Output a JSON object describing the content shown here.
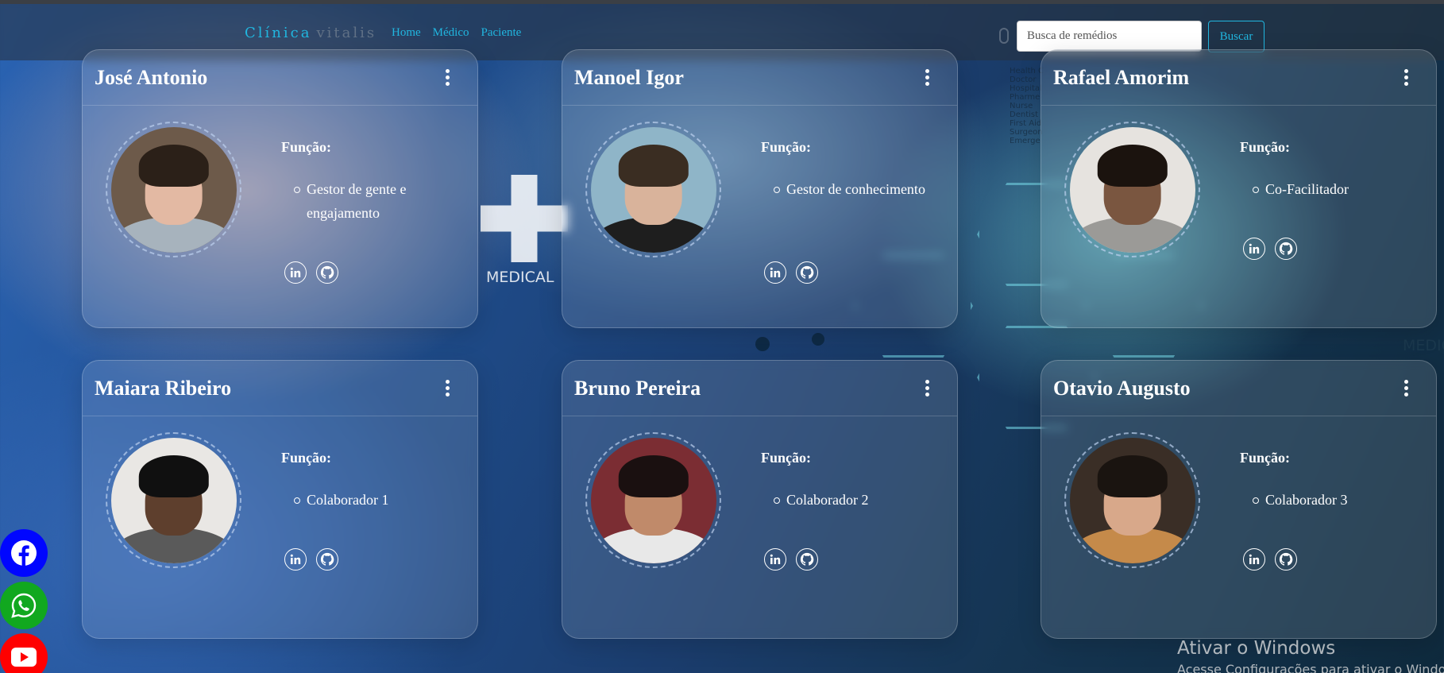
{
  "navbar": {
    "brand_first": "Clínica",
    "brand_second": "vitalis",
    "links": [
      "Home",
      "Médico",
      "Paciente"
    ],
    "search_placeholder": "Busca de remédios",
    "search_button": "Buscar"
  },
  "role_label": "Função:",
  "cards": [
    {
      "name": "José Antonio",
      "role": "Gestor de gente e engajamento"
    },
    {
      "name": "Manoel Igor",
      "role": "Gestor de conhecimento"
    },
    {
      "name": "Rafael Amorim",
      "role": "Co-Facilitador"
    },
    {
      "name": "Maiara Ribeiro",
      "role": "Colaborador 1"
    },
    {
      "name": "Bruno Pereira",
      "role": "Colaborador 2"
    },
    {
      "name": "Otavio Augusto",
      "role": "Colaborador 3"
    }
  ],
  "background_text": {
    "medical": "MEDICAL",
    "medic_right": "MEDIC",
    "health_list": [
      "Health C",
      "Doctor",
      "Hospital",
      "Pharme",
      "Nurse",
      "Dentist",
      "First Aid",
      "Surgeon",
      "Emerge"
    ]
  },
  "watermark": {
    "title": "Ativar o Windows",
    "subtitle": "Acesse Configurações para ativar o Windows."
  },
  "colors": {
    "accent": "#21b7e0",
    "facebook": "#0006ff",
    "whatsapp": "#11a81f",
    "youtube": "#ff0000"
  },
  "icons": [
    "kebab-menu-icon",
    "linkedin-icon",
    "github-icon",
    "facebook-icon",
    "whatsapp-icon",
    "youtube-icon",
    "microphone-icon"
  ]
}
